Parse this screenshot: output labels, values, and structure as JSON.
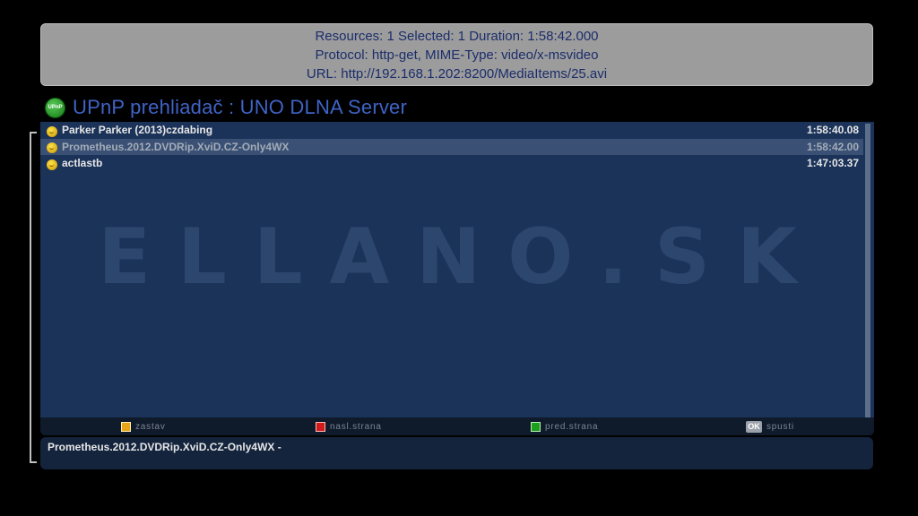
{
  "info": {
    "line1": "Resources: 1 Selected: 1 Duration: 1:58:42.000",
    "line2": "Protocol: http-get, MIME-Type: video/x-msvideo",
    "line3": "URL: http://192.168.1.202:8200/MediaItems/25.avi"
  },
  "header": {
    "logo_text": "UPnP",
    "title": "UPnP prehliadač : UNO DLNA Server"
  },
  "watermark_text": "ELLANO.SK",
  "items": [
    {
      "name": "Parker  Parker (2013)czdabing",
      "duration": "1:58:40.08",
      "icon": "video-file-icon"
    },
    {
      "name": "Prometheus.2012.DVDRip.XviD.CZ-Only4WX",
      "duration": "1:58:42.00",
      "icon": "video-file-icon"
    },
    {
      "name": "actlastb",
      "duration": "1:47:03.37",
      "icon": "video-file-icon"
    }
  ],
  "footer": {
    "yellow_label": "zastav",
    "red_label": "nasl.strana",
    "green_label": "pred.strana",
    "ok_key": "OK",
    "ok_label": "spusti"
  },
  "detail": {
    "text": "Prometheus.2012.DVDRip.XviD.CZ-Only4WX  -"
  },
  "colors": {
    "accent_title": "#3f63c6",
    "panel_bg": "#1b3359",
    "selected_row": "#3a5175"
  }
}
